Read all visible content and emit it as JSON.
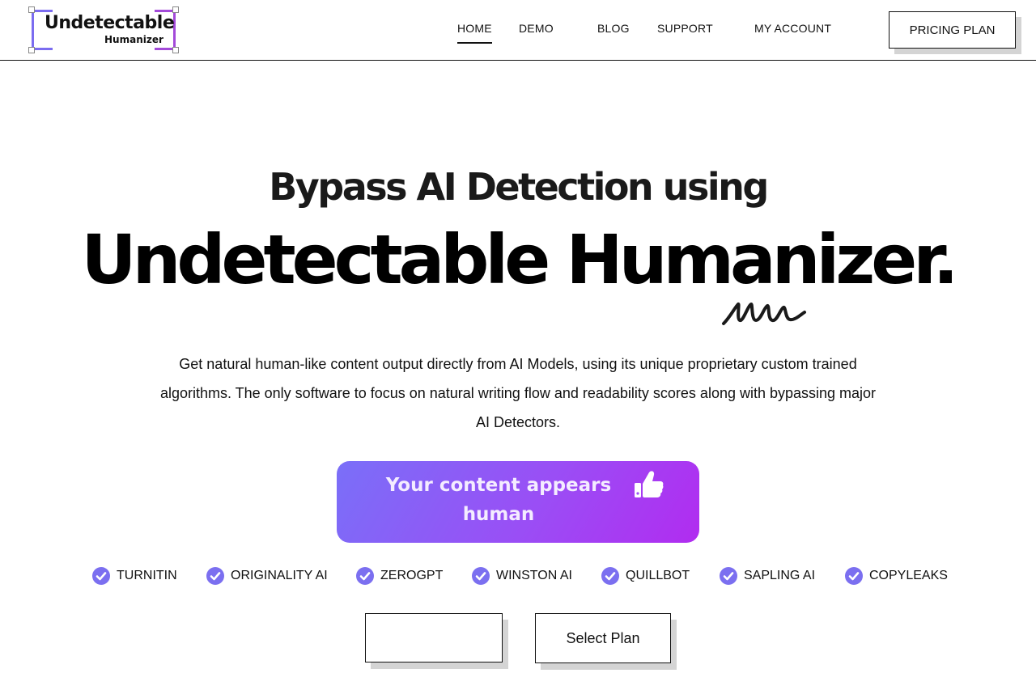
{
  "logo": {
    "line1": "Undetectable",
    "line2": "Humanizer"
  },
  "nav": {
    "items": [
      {
        "label": "HOME",
        "active": true
      },
      {
        "label": "DEMO",
        "active": false
      },
      {
        "label": "BLOG",
        "active": false
      },
      {
        "label": "SUPPORT",
        "active": false
      },
      {
        "label": "MY ACCOUNT",
        "active": false
      }
    ],
    "pricing_label": "PRICING PLAN"
  },
  "hero": {
    "subtitle": "Bypass AI Detection using",
    "title": "Undetectable Humanizer.",
    "description": "Get natural human-like content output directly from AI Models, using its unique proprietary custom trained algorithms. The only software to focus on natural writing flow and readability scores along with bypassing major AI Detectors.",
    "status_button": "Your content appears human",
    "status_icon": "thumbs-up-icon"
  },
  "detectors": [
    "TURNITIN",
    "ORIGINALITY AI",
    "ZEROGPT",
    "WINSTON AI",
    "QUILLBOT",
    "SAPLING AI",
    "COPYLEAKS"
  ],
  "actions": {
    "empty_button": "",
    "select_plan": "Select Plan"
  },
  "colors": {
    "accent_start": "#7a6ff8",
    "accent_end": "#b12cf0",
    "check": "#7b6ff0"
  }
}
